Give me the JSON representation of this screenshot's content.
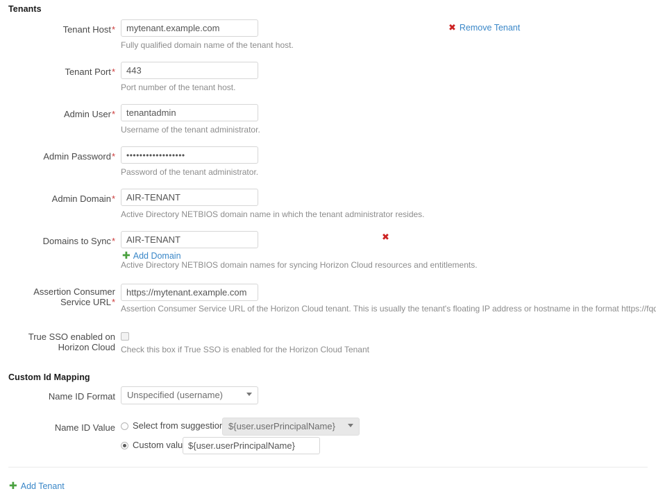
{
  "sections": {
    "tenants_title": "Tenants",
    "custom_id_title": "Custom Id Mapping"
  },
  "actions": {
    "remove_tenant": "Remove Tenant",
    "add_domain": "Add Domain",
    "add_tenant": "Add Tenant",
    "remove_domain_icon": "✖",
    "remove_tenant_icon": "✖",
    "plus_icon": "✚"
  },
  "fields": {
    "tenant_host": {
      "label": "Tenant Host",
      "required": "*",
      "value": "mytenant.example.com",
      "help": "Fully qualified domain name of the tenant host."
    },
    "tenant_port": {
      "label": "Tenant Port",
      "required": "*",
      "value": "443",
      "help": "Port number of the tenant host."
    },
    "admin_user": {
      "label": "Admin User",
      "required": "*",
      "value": "tenantadmin",
      "help": "Username of the tenant administrator."
    },
    "admin_password": {
      "label": "Admin Password",
      "required": "*",
      "value": "••••••••••••••••••",
      "help": "Password of the tenant administrator."
    },
    "admin_domain": {
      "label": "Admin Domain",
      "required": "*",
      "value": "AIR-TENANT",
      "help": "Active Directory NETBIOS domain name in which the tenant administrator resides."
    },
    "domains_to_sync": {
      "label": "Domains to Sync",
      "required": "*",
      "value": "AIR-TENANT",
      "help": "Active Directory NETBIOS domain names for syncing Horizon Cloud resources and entitlements."
    },
    "assertion_url": {
      "label_line1": "Assertion Consumer",
      "label_line2": "Service URL",
      "required": "*",
      "value": "https://mytenant.example.com",
      "help": "Assertion Consumer Service URL of the Horizon Cloud tenant. This is usually the tenant's floating IP address or hostname in the format https://fqdn."
    },
    "true_sso": {
      "label_line1": "True SSO enabled on",
      "label_line2": "Horizon Cloud",
      "checked": false,
      "help": "Check this box if True SSO is enabled for the Horizon Cloud Tenant"
    },
    "name_id_format": {
      "label": "Name ID Format",
      "value": "Unspecified (username)"
    },
    "name_id_value": {
      "label": "Name ID Value",
      "suggestion_radio_label": "Select from suggestions",
      "suggestion_radio_selected": false,
      "suggestion_value": "${user.userPrincipalName}",
      "custom_radio_label": "Custom value",
      "custom_radio_selected": true,
      "custom_value": "${user.userPrincipalName}"
    }
  },
  "colors": {
    "link": "#3a87c8",
    "required_asterisk": "#cc3b3b",
    "remove_icon": "#cc2222",
    "add_icon": "#4aa13f",
    "help_text": "#8c8c8c",
    "label_text": "#4a4a4a",
    "input_border": "#d6d6d6"
  }
}
